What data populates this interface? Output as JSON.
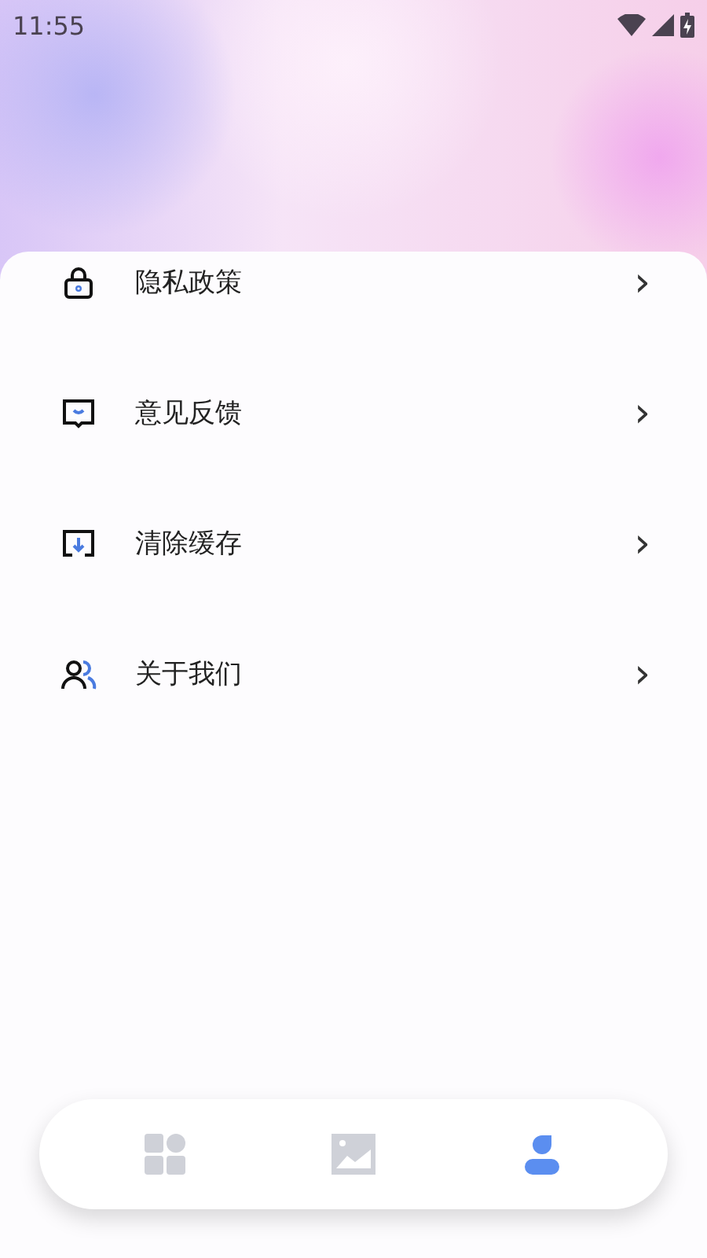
{
  "status_bar": {
    "time": "11:55"
  },
  "menu": [
    {
      "kind": "lock",
      "label": "隐私政策",
      "chevron": "›"
    },
    {
      "kind": "feedback",
      "label": "意见反馈",
      "chevron": "›"
    },
    {
      "kind": "download",
      "label": "清除缓存",
      "chevron": "›"
    },
    {
      "kind": "people",
      "label": "关于我们",
      "chevron": "›"
    }
  ],
  "nav": [
    {
      "kind": "grid",
      "selected": false
    },
    {
      "kind": "image",
      "selected": false
    },
    {
      "kind": "person",
      "selected": true
    }
  ]
}
